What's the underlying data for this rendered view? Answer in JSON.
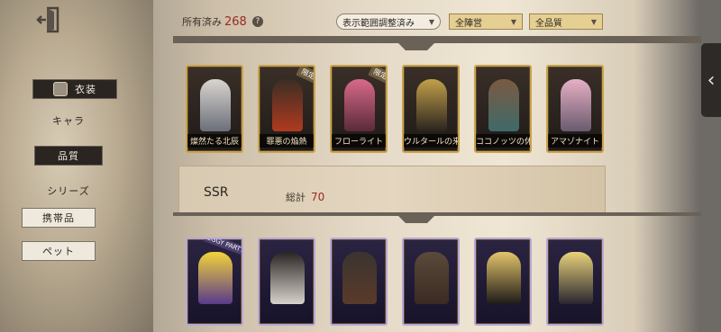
{
  "sidebar": {
    "items": [
      {
        "label": "衣装"
      },
      {
        "label": "キャラ"
      },
      {
        "label": "品質"
      },
      {
        "label": "シリーズ"
      },
      {
        "label": "携帯品"
      },
      {
        "label": "ペット"
      }
    ]
  },
  "header": {
    "owned_label": "所有済み",
    "owned_count": "268",
    "help_glyph": "?",
    "filters": [
      {
        "label": "表示範囲調整済み"
      },
      {
        "label": "全陣営"
      },
      {
        "label": "全品質"
      }
    ]
  },
  "top_cards": [
    {
      "name": "燦然たる北辰",
      "limited": ""
    },
    {
      "name": "罪悪の焔熱",
      "limited": "限定"
    },
    {
      "name": "フローライト",
      "limited": "限定"
    },
    {
      "name": "ウルタールの来客",
      "limited": ""
    },
    {
      "name": "ココノッツの休日",
      "limited": ""
    },
    {
      "name": "アマゾナイト",
      "limited": ""
    }
  ],
  "ssr_section": {
    "title": "SSR",
    "total_label": "総計",
    "total_value": "70"
  },
  "bottom_cards": [
    {
      "badge": "EGGY PARTY"
    },
    {
      "badge": ""
    },
    {
      "badge": ""
    },
    {
      "badge": ""
    },
    {
      "badge": ""
    },
    {
      "badge": ""
    }
  ],
  "colors": {
    "accent_red": "#9a2a23",
    "gold_border": "#c9a24e",
    "dark_tab": "#2a2521"
  },
  "icons": {
    "exit": "exit-door-icon",
    "toggle": "chevron-left-icon",
    "costume": "costume-shield-icon"
  }
}
